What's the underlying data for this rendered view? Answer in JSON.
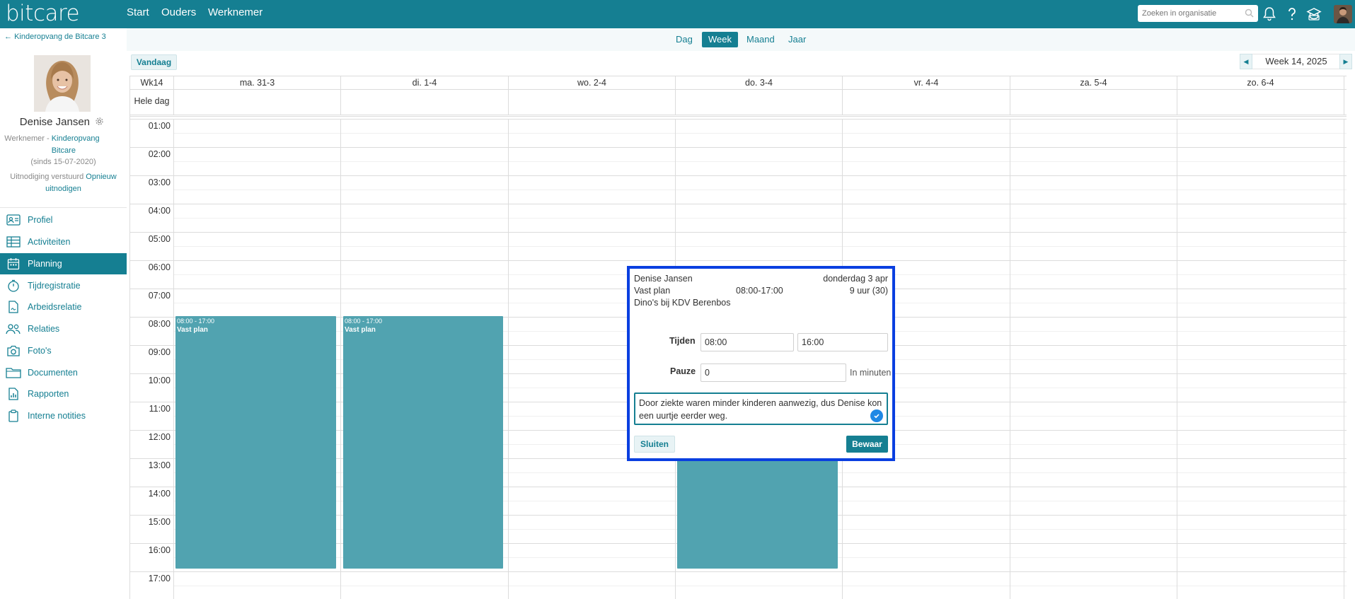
{
  "app": {
    "logo": "bitcare"
  },
  "topnav": {
    "items": [
      "Start",
      "Ouders",
      "Werknemer"
    ]
  },
  "search": {
    "placeholder": "Zoeken in organisatie"
  },
  "sidebar": {
    "back_link": "Kinderopvang de Bitcare 3",
    "profile": {
      "name": "Denise Jansen",
      "role": "Werknemer",
      "org": "Kinderopvang Bitcare",
      "since": "(sinds 15-07-2020)",
      "invite_text": "Uitnodiging verstuurd",
      "invite_link": "Opnieuw uitnodigen"
    },
    "menu": [
      {
        "label": "Profiel",
        "icon": "id-card-icon"
      },
      {
        "label": "Activiteiten",
        "icon": "table-icon"
      },
      {
        "label": "Planning",
        "icon": "calendar-icon",
        "active": true
      },
      {
        "label": "Tijdregistratie",
        "icon": "stopwatch-icon"
      },
      {
        "label": "Arbeidsrelatie",
        "icon": "contract-icon"
      },
      {
        "label": "Relaties",
        "icon": "people-icon"
      },
      {
        "label": "Foto's",
        "icon": "camera-icon"
      },
      {
        "label": "Documenten",
        "icon": "folder-icon"
      },
      {
        "label": "Rapporten",
        "icon": "report-icon"
      },
      {
        "label": "Interne notities",
        "icon": "clipboard-icon"
      }
    ]
  },
  "views": {
    "tabs": [
      "Dag",
      "Week",
      "Maand",
      "Jaar"
    ],
    "active": "Week"
  },
  "toolbar": {
    "today": "Vandaag",
    "week_label": "Week 14, 2025"
  },
  "calendar": {
    "week_col": "Wk14",
    "days": [
      "ma. 31-3",
      "di. 1-4",
      "wo. 2-4",
      "do. 3-4",
      "vr. 4-4",
      "za. 5-4",
      "zo. 6-4"
    ],
    "allday_label": "Hele dag",
    "hours": [
      "01:00",
      "02:00",
      "03:00",
      "04:00",
      "05:00",
      "06:00",
      "07:00",
      "08:00",
      "09:00",
      "10:00",
      "11:00",
      "12:00",
      "13:00",
      "14:00",
      "15:00",
      "16:00",
      "17:00"
    ],
    "events": [
      {
        "day": 0,
        "time": "08:00 - 17:00",
        "title": "Vast plan"
      },
      {
        "day": 1,
        "time": "08:00 - 17:00",
        "title": "Vast plan"
      },
      {
        "day": 3,
        "time": "",
        "title": ""
      }
    ]
  },
  "popup": {
    "name": "Denise Jansen",
    "date": "donderdag 3 apr",
    "plan": "Vast plan",
    "plan_time": "08:00-17:00",
    "duration": "9 uur (30)",
    "location": "Dino's bij KDV Berenbos",
    "tijden_label": "Tijden",
    "start": "08:00",
    "end": "16:00",
    "pauze_label": "Pauze",
    "pauze": "0",
    "pauze_unit": "In minuten",
    "note": "Door ziekte waren minder kinderen aanwezig, dus Denise kon een uurtje eerder weg.",
    "close": "Sluiten",
    "save": "Bewaar"
  }
}
